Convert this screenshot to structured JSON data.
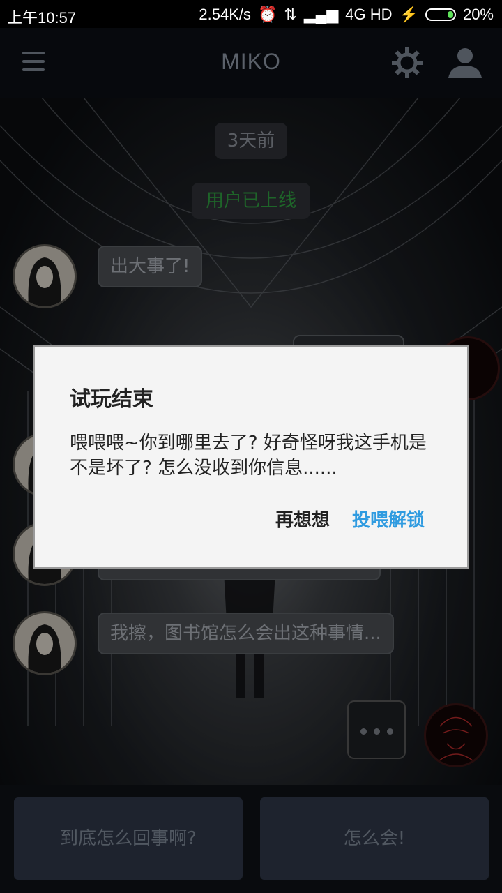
{
  "status_bar": {
    "time": "上午10:57",
    "speed": "2.54K/s",
    "network": "4G HD",
    "battery": "20%",
    "battery_fill": 0.2
  },
  "header": {
    "title": "MIKO"
  },
  "chat": {
    "time_label": "3天前",
    "online_label": "用户已上线",
    "messages": [
      {
        "text": "出大事了!"
      },
      {
        "text": "我擦，图书馆怎么会出这种事情..."
      }
    ]
  },
  "dialog": {
    "title": "试玩结束",
    "message": "喂喂喂~你到哪里去了? 好奇怪呀我这手机是不是坏了? 怎么没收到你信息......",
    "cancel_label": "再想想",
    "confirm_label": "投喂解锁"
  },
  "replies": [
    "到底怎么回事啊?",
    "怎么会!"
  ],
  "colors": {
    "accent": "#2f9be0",
    "online": "#2f9b3f",
    "reply_bg": "#2f3747"
  }
}
